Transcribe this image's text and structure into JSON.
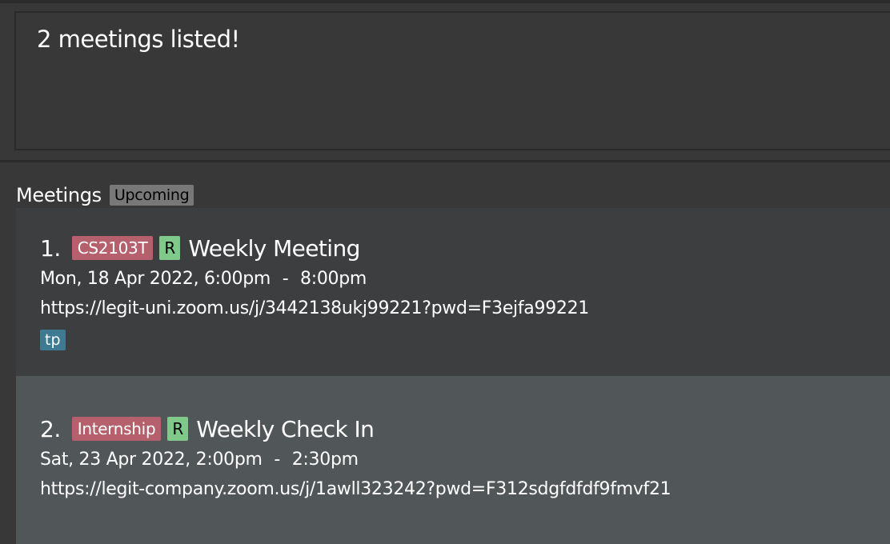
{
  "result": {
    "message": "2 meetings listed!"
  },
  "meetings_panel": {
    "title": "Meetings",
    "filter_badge": "Upcoming"
  },
  "meetings": [
    {
      "index": "1.",
      "module": "CS2103T",
      "recurring": "R",
      "name": "Weekly Meeting",
      "start": "Mon, 18 Apr 2022, 6:00pm",
      "separator": "-",
      "end": "8:00pm",
      "link": "https://legit-uni.zoom.us/j/3442138ukj99221?pwd=F3ejfa99221",
      "tags": [
        "tp"
      ]
    },
    {
      "index": "2.",
      "module": "Internship",
      "recurring": "R",
      "name": "Weekly Check In",
      "start": "Sat, 23 Apr 2022, 2:00pm",
      "separator": "-",
      "end": "2:30pm",
      "link": "https://legit-company.zoom.us/j/1awll323242?pwd=F312sdgfdfdf9fmvf21",
      "tags": []
    }
  ],
  "colors": {
    "background": "#383838",
    "card_odd": "#3c3e40",
    "card_even": "#515658",
    "module_tag": "#b5606c",
    "recurring_tag": "#7fc98a",
    "label_tag": "#3e7a92",
    "filter_badge": "#787878"
  }
}
